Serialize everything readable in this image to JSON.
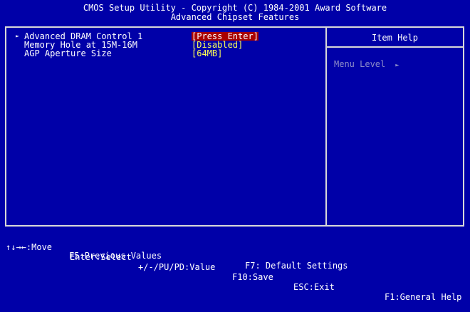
{
  "header": {
    "line1": "CMOS Setup Utility - Copyright (C) 1984-2001 Award Software",
    "line2": "Advanced Chipset Features"
  },
  "settings": [
    {
      "label": "Advanced DRAM Control 1",
      "value": "Press Enter",
      "submenu": true
    },
    {
      "label": "Memory Hole at 15M-16M",
      "value": "Disabled",
      "submenu": false
    },
    {
      "label": "AGP Aperture Size",
      "value": "64MB",
      "submenu": false
    }
  ],
  "help_panel": {
    "title": "Item Help",
    "menu_level_label": "Menu Level",
    "menu_level_arrow": "►"
  },
  "footer": {
    "move": "↑↓→←:Move",
    "enter": "Enter:Select",
    "value": "+/-/PU/PD:Value",
    "save": "F10:Save",
    "exit": "ESC:Exit",
    "help": "F1:General Help",
    "prev": "F5:Previous Values",
    "defaults": "F7: Default Settings"
  },
  "colors": {
    "background": "#0000a8",
    "value_text": "#ffff54",
    "selected_bg": "#a80000",
    "border": "#d8d8d8"
  }
}
